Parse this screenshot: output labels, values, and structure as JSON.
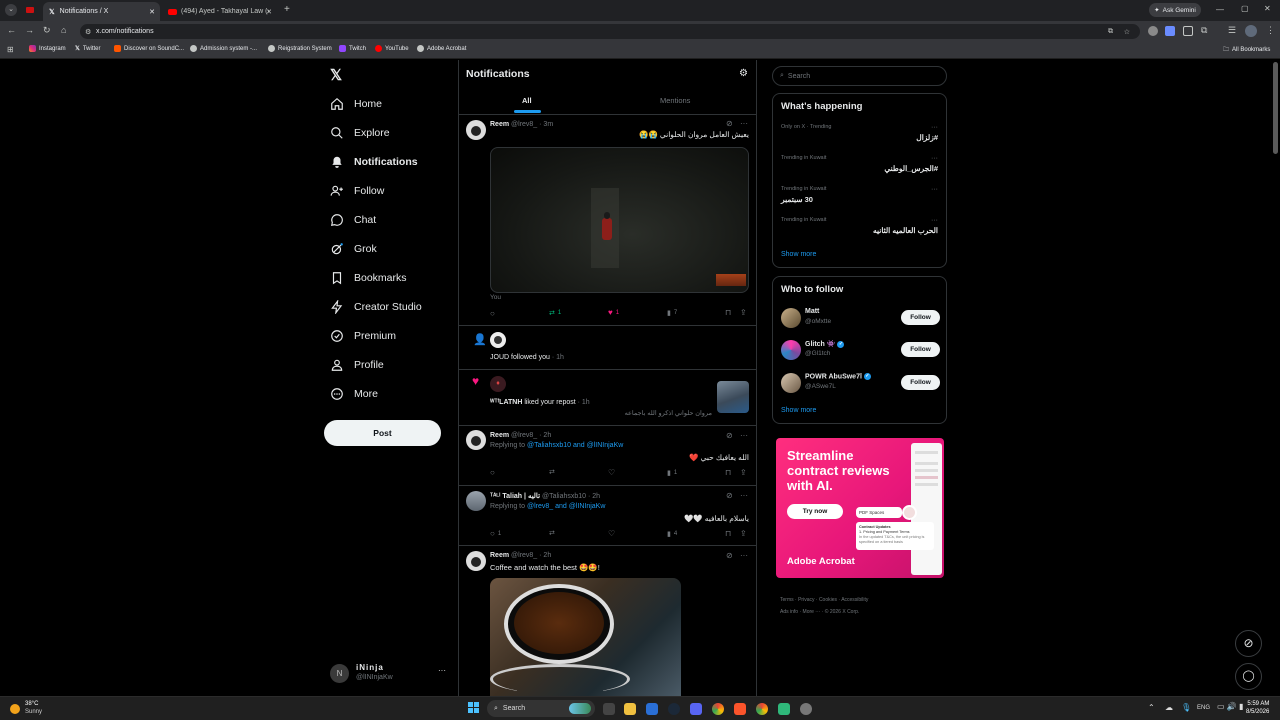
{
  "browser": {
    "tabs": [
      {
        "label": "Notifications / X",
        "active": true
      },
      {
        "label": "(494) Ayed - Takhayal Law (Ay...",
        "active": false
      }
    ],
    "address": "x.com/notifications",
    "ask_gemini": "Ask Gemini",
    "all_bookmarks": "All Bookmarks",
    "bookmarks": [
      "Instagram",
      "Twitter",
      "Discover on SoundC...",
      "Admission system -...",
      "Reigstration System",
      "Twitch",
      "YouTube",
      "Adobe Acrobat"
    ]
  },
  "nav": {
    "items": [
      "Home",
      "Explore",
      "Notifications",
      "Follow",
      "Chat",
      "Grok",
      "Bookmarks",
      "Creator Studio",
      "Premium",
      "Profile",
      "More"
    ],
    "post_label": "Post",
    "account": {
      "name": "iNinja",
      "handle": "@lINInjaKw"
    }
  },
  "header": {
    "title": "Notifications",
    "tabs": [
      "All",
      "Mentions"
    ]
  },
  "feed": {
    "t1": {
      "name": "Reem",
      "handle": "@lrev8_",
      "time": "· 3m",
      "text": "يعيش العامل مروان الحلواني 😭😭",
      "caption": "You",
      "reposts": "1",
      "likes": "1",
      "views": "7"
    },
    "n1": {
      "text": "JOUD followed you",
      "time": " · 1h"
    },
    "n2": {
      "name": "ᵂᵀᶠLATNH",
      "text": " liked your repost",
      "time": " · 1h",
      "sub": "مروان حلواني اذكرو الله باجماعه"
    },
    "t2": {
      "name": "Reem",
      "handle": "@lrev8_",
      "time": "· 2h",
      "replying": "Replying to",
      "mentions": "@Taliahsxb10 and @lINInjaKw",
      "text": "الله يعافيك حبي ❤️",
      "likes": "1"
    },
    "t3": {
      "name": "ᵀᴬᴸᴵ Taliah | تاليه",
      "handle": "@Taliahsxb10",
      "time": "· 2h",
      "replying": "Replying to",
      "mentions": "@lrev8_ and @lINInjaKw",
      "text": "ياسلام بالعافيه 🤍🤍",
      "replies": "1",
      "views": "4"
    },
    "t4": {
      "name": "Reem",
      "handle": "@lrev8_",
      "time": "· 2h",
      "text": "Coffee and watch the best 🤩🤩!"
    }
  },
  "search": {
    "placeholder": "Search"
  },
  "happening": {
    "title": "What's happening",
    "trends": [
      {
        "context": "Only on X · Trending",
        "topic": "#زلزال"
      },
      {
        "context": "Trending in Kuwait",
        "topic": "#الجرس_الوطني"
      },
      {
        "context": "Trending in Kuwait",
        "topic": "30 سبتمبر"
      },
      {
        "context": "Trending in Kuwait",
        "topic": "الحرب العالميه الثانيه"
      }
    ],
    "show_more": "Show more"
  },
  "who_to_follow": {
    "title": "Who to follow",
    "users": [
      {
        "name": "Matt",
        "handle": "@oMxtte",
        "button": "Follow"
      },
      {
        "name": "Glitch 👾",
        "handle": "@Gl1tch",
        "button": "Follow"
      },
      {
        "name": "POWR AbuSwe7l",
        "handle": "@ASwe7L",
        "button": "Follow"
      }
    ],
    "show_more": "Show more"
  },
  "ad": {
    "headline": "Streamline contract reviews with AI.",
    "cta": "Try now",
    "brand": "Adobe Acrobat",
    "doc_tag": "PDF Spaces",
    "doc_title": "Contract Updates",
    "doc_line1": "1. Pricing and Payment Terms",
    "doc_line2": "In the updated T&Cs, the unit pricing is specified on a tiered basis"
  },
  "footer": {
    "links": [
      "Terms",
      "Privacy",
      "Cookies",
      "Accessibility",
      "Ads info",
      "More ···",
      "© 2026 X Corp."
    ]
  },
  "taskbar": {
    "weather_temp": "38°C",
    "weather_desc": "Sunny",
    "search": "Search",
    "lang": "ENG",
    "time": "5:59 AM",
    "date": "8/5/2026"
  },
  "colors": {
    "accent": "#1d9bf0",
    "like": "#f91880",
    "repost": "#00ba7c"
  }
}
